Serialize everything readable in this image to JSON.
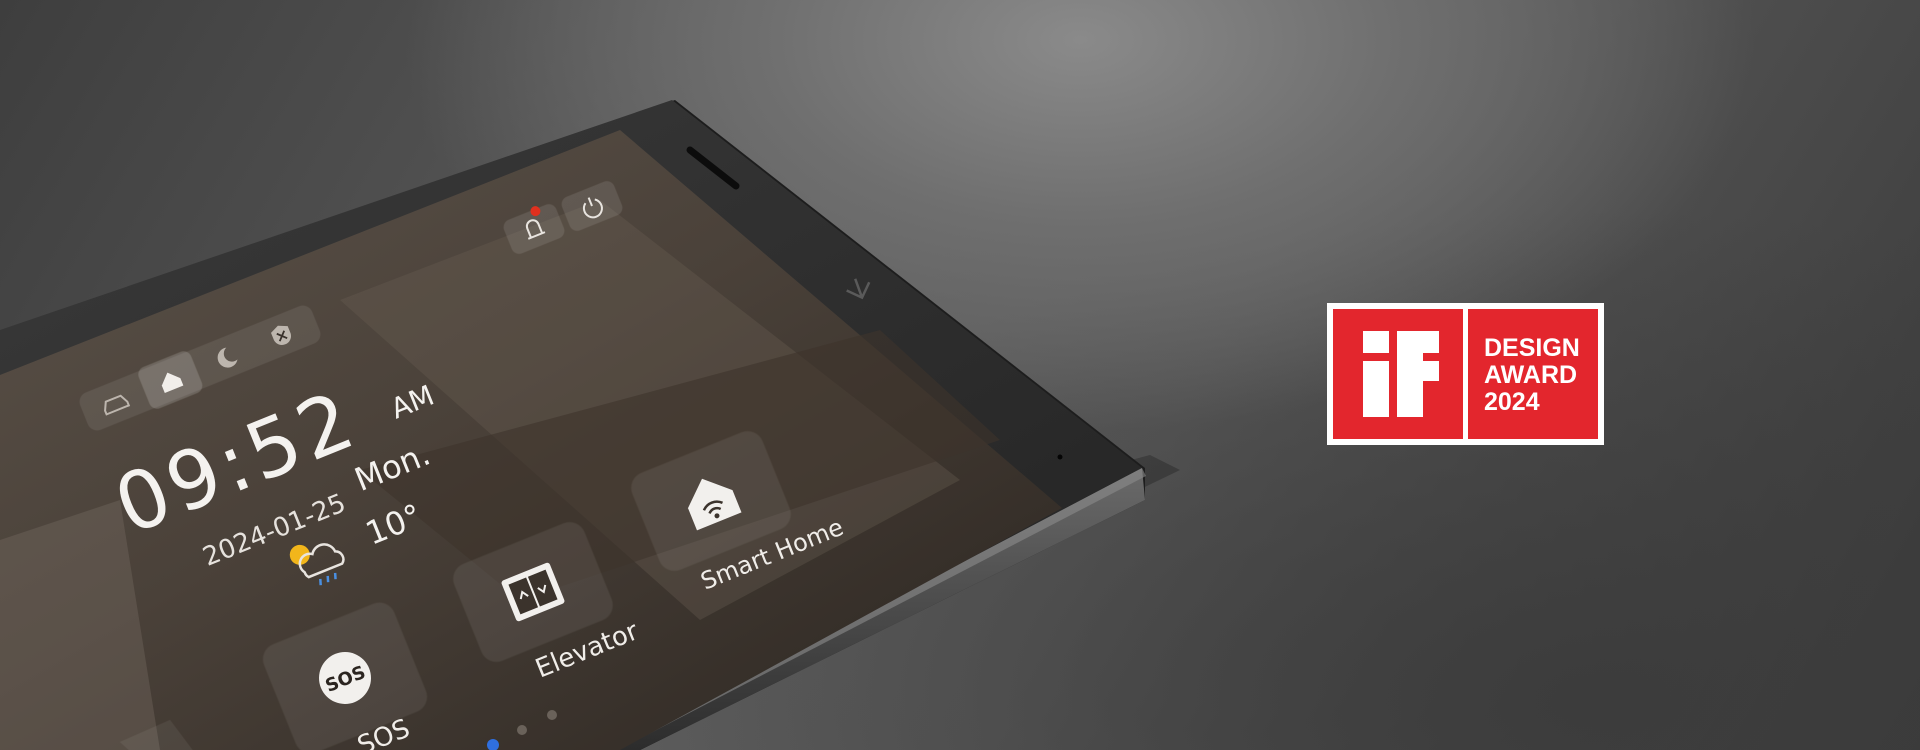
{
  "device": {
    "status_icons": [
      "alarm-bell-icon",
      "power-icon"
    ],
    "mode_icons": [
      "away-mode-icon",
      "home-mode-icon",
      "sleep-mode-icon",
      "disarm-mode-icon"
    ],
    "time": "09:52",
    "meridiem": "AM",
    "date": "2024-01-25",
    "weekday": "Mon.",
    "temperature": "10°",
    "weather_icon": "partly-cloudy-rain-icon",
    "apps": [
      {
        "label": "SOS",
        "icon": "sos-icon",
        "icon_text": "SOS"
      },
      {
        "label": "Elevator",
        "icon": "elevator-icon"
      },
      {
        "label": "Smart Home",
        "icon": "smart-home-icon"
      }
    ],
    "page_dots": {
      "active_index": 0,
      "count": 3
    },
    "brand_logo": "device-brand-logo"
  },
  "award": {
    "logo": "iF",
    "lines": [
      "DESIGN",
      "AWARD",
      "2024"
    ],
    "colors": {
      "red": "#e3262d",
      "white": "#ffffff"
    }
  }
}
